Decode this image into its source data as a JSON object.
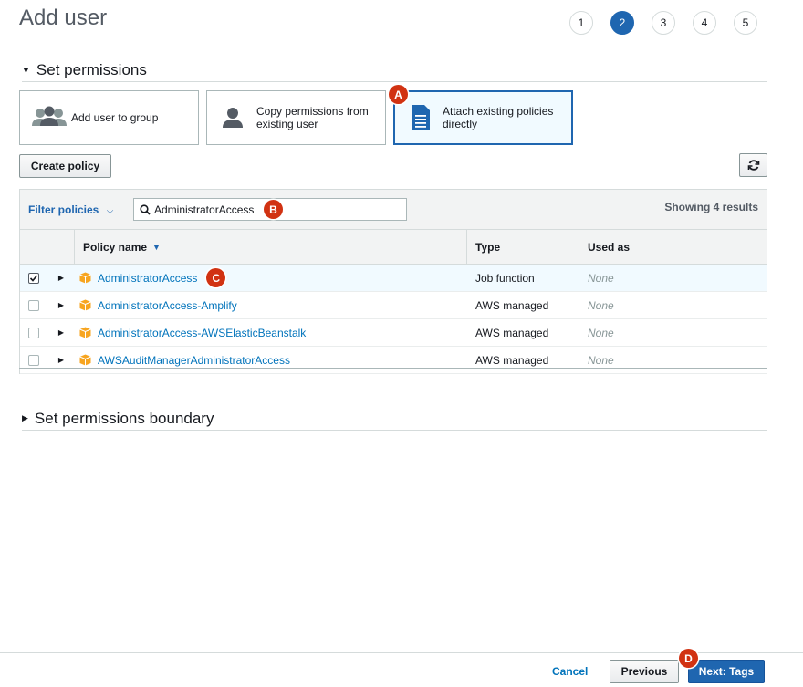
{
  "page": {
    "title": "Add user"
  },
  "steps": [
    "1",
    "2",
    "3",
    "4",
    "5"
  ],
  "active_step": "2",
  "permissions_section": {
    "label": "Set permissions"
  },
  "options": {
    "add_to_group": "Add user to group",
    "copy_permissions": "Copy permissions from existing user",
    "attach_policies": "Attach existing policies directly"
  },
  "toolbar": {
    "create_policy": "Create policy",
    "refresh_icon": "refresh-icon"
  },
  "filter": {
    "label": "Filter policies",
    "search_value": "AdministratorAccess",
    "results": "Showing 4 results"
  },
  "table": {
    "headers": {
      "name": "Policy name",
      "type": "Type",
      "used_as": "Used as"
    },
    "rows": [
      {
        "name": "AdministratorAccess",
        "type": "Job function",
        "used_as": "None",
        "checked": true
      },
      {
        "name": "AdministratorAccess-Amplify",
        "type": "AWS managed",
        "used_as": "None",
        "checked": false
      },
      {
        "name": "AdministratorAccess-AWSElasticBeanstalk",
        "type": "AWS managed",
        "used_as": "None",
        "checked": false
      },
      {
        "name": "AWSAuditManagerAdministratorAccess",
        "type": "AWS managed",
        "used_as": "None",
        "checked": false
      }
    ]
  },
  "boundary_section": {
    "label": "Set permissions boundary"
  },
  "annotations": {
    "a": "A",
    "b": "B",
    "c": "C",
    "d": "D"
  },
  "footer": {
    "cancel": "Cancel",
    "previous": "Previous",
    "next": "Next: Tags"
  },
  "colors": {
    "accent": "#1f66b0",
    "badge": "#d13212",
    "link": "#0073bb",
    "policy_icon": "#f7a520"
  }
}
